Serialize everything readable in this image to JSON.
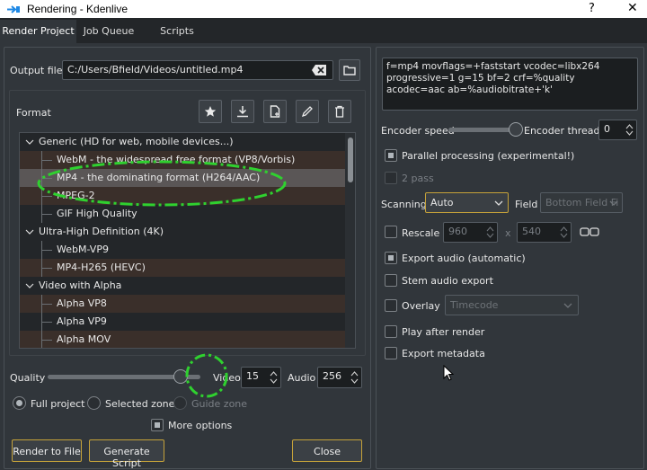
{
  "window": {
    "title": "Rendering - Kdenlive",
    "help": "?",
    "close": "✕"
  },
  "tabs": [
    "Render Project",
    "Job Queue",
    "Scripts"
  ],
  "output": {
    "label": "Output file",
    "value": "C:/Users/Bfield/Videos/untitled.mp4"
  },
  "format": {
    "label": "Format",
    "tree": [
      {
        "text": "Generic (HD for web, mobile devices...)",
        "level": 0,
        "group": true
      },
      {
        "text": "WebM - the widespread free format (VP8/Vorbis)",
        "level": 1
      },
      {
        "text": "MP4 - the dominating format (H264/AAC)",
        "level": 1,
        "selected": true
      },
      {
        "text": "MPEG-2",
        "level": 1
      },
      {
        "text": "GIF High Quality",
        "level": 1
      },
      {
        "text": "Ultra-High Definition (4K)",
        "level": 0,
        "group": true
      },
      {
        "text": "WebM-VP9",
        "level": 1
      },
      {
        "text": "MP4-H265 (HEVC)",
        "level": 1
      },
      {
        "text": "Video with Alpha",
        "level": 0,
        "group": true
      },
      {
        "text": "Alpha VP8",
        "level": 1
      },
      {
        "text": "Alpha VP9",
        "level": 1
      },
      {
        "text": "Alpha MOV",
        "level": 1
      }
    ]
  },
  "quality": {
    "label": "Quality",
    "level_percent": 87,
    "video_label": "Video",
    "video_value": "15",
    "audio_label": "Audio",
    "audio_value": "256"
  },
  "zones": {
    "full": "Full project",
    "selected": "Selected zone",
    "guide": "Guide zone"
  },
  "more_options": "More options",
  "buttons": {
    "render": "Render to File",
    "script": "Generate Script",
    "close": "Close"
  },
  "params": "f=mp4 movflags=+faststart vcodec=libx264 progressive=1 g=15 bf=2 crf=%quality acodec=aac ab=%audiobitrate+'k'",
  "encoder": {
    "speed_label": "Encoder speed",
    "speed_percent": 100,
    "threads_label": "Encoder threads",
    "threads_value": "0"
  },
  "options": {
    "parallel": "Parallel processing (experimental!)",
    "two_pass": "2 pass",
    "scanning_label": "Scanning",
    "scanning_value": "Auto",
    "field_label": "Field",
    "field_value": "Bottom Field Fi",
    "rescale": "Rescale",
    "rescale_w": "960",
    "rescale_h": "540",
    "rescale_x": "x",
    "export_audio": "Export audio (automatic)",
    "stem_audio": "Stem audio export",
    "overlay": "Overlay",
    "overlay_value": "Timecode",
    "play_after": "Play after render",
    "export_meta": "Export metadata"
  },
  "colors": {
    "accent_yellow": "#c5a23a",
    "annotation_green": "#2fd12f"
  }
}
